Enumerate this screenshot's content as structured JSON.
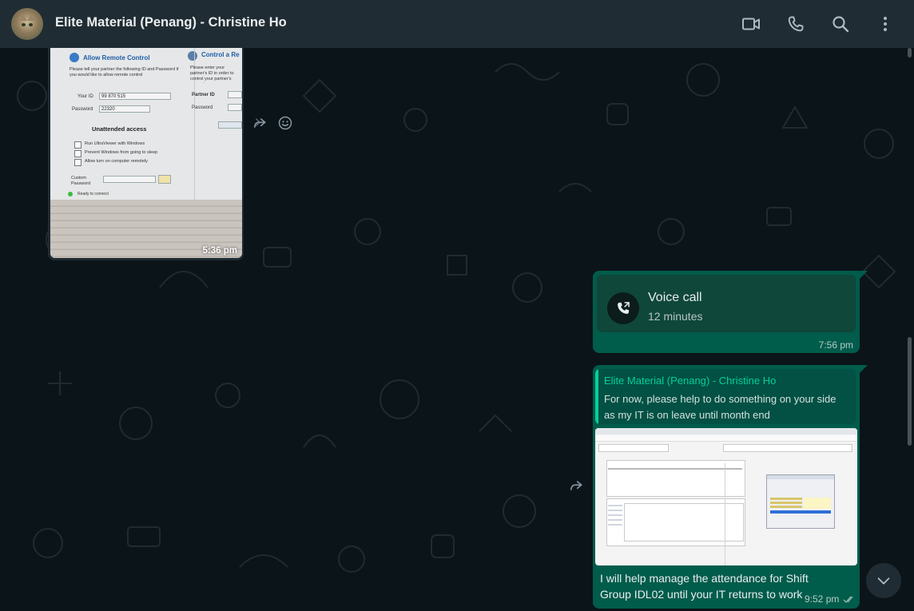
{
  "header": {
    "contact_name": "Elite Material (Penang) - Christine Ho",
    "icons": [
      "video-call-icon",
      "voice-call-icon",
      "search-icon",
      "menu-icon"
    ]
  },
  "messages": {
    "image_in": {
      "time": "5:36 pm",
      "screen_text": {
        "allow_remote": "Allow Remote Control",
        "control_remote": "Control a Re",
        "instructions": "Please tell your partner the following ID and Password if you would like to allow remote control",
        "instructions_right": "Please enter your partner's ID in order to control your partner's computer.",
        "your_id_label": "Your ID",
        "your_id_value": "99 870 515",
        "password_label": "Password",
        "password_value": "22320",
        "partner_id_label": "Partner ID",
        "partner_password_label": "Password",
        "unattended": "Unattended access",
        "opt1": "Run UltraViewer with Windows",
        "opt2": "Prevent Windows from going to sleep",
        "opt3": "Allow turn on computer remotely",
        "custom_password": "Custom Password",
        "status": "Ready to connect"
      }
    },
    "voice_call": {
      "title": "Voice call",
      "duration": "12 minutes",
      "time": "7:56 pm"
    },
    "reply": {
      "quoted_name": "Elite Material (Penang) - Christine Ho",
      "quoted_text": "For now, please help to do something on your side as my IT is on leave until month end",
      "text": "I will help manage the attendance for Shift Group IDL02 until your IT returns to work",
      "time": "9:52 pm"
    }
  },
  "colors": {
    "header_bg": "#202c33",
    "chat_bg": "#0b1419",
    "outgoing_bubble": "#005c4b",
    "accent": "#06cf9c"
  }
}
